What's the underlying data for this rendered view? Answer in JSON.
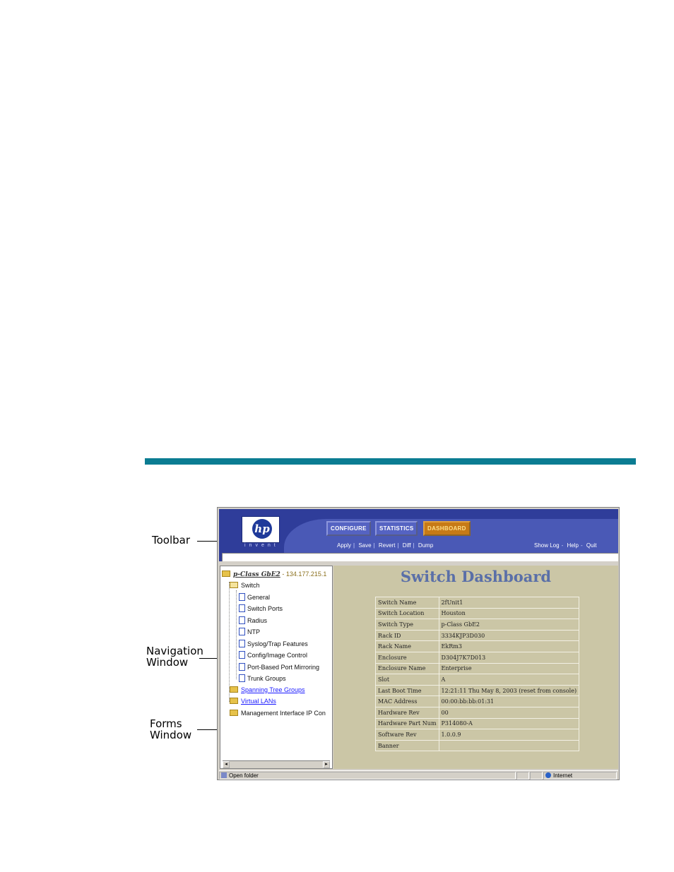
{
  "callouts": {
    "toolbar": "Toolbar",
    "navigation": [
      "Navigation",
      "Window"
    ],
    "forms": [
      "Forms",
      "Window"
    ]
  },
  "toolbar": {
    "logo_text": "hp",
    "logo_sub": "invent",
    "tabs": [
      {
        "label": "CONFIGURE",
        "active": false
      },
      {
        "label": "STATISTICS",
        "active": false
      },
      {
        "label": "DASHBOARD",
        "active": true
      }
    ],
    "actions": [
      "Apply",
      "Save",
      "Revert",
      "Diff",
      "Dump"
    ],
    "right_links": [
      "Show Log",
      "Help",
      "Quit"
    ]
  },
  "nav": {
    "root": "p-Class GbE2",
    "root_ip": "- 134.177.215.1",
    "switch": "Switch",
    "switch_items": [
      "General",
      "Switch Ports",
      "Radius",
      "NTP",
      "Syslog/Trap Features",
      "Config/Image Control",
      "Port-Based Port Mirroring",
      "Trunk Groups"
    ],
    "links": [
      "Spanning Tree Groups",
      "Virtual LANs"
    ],
    "mgmt": "Management Interface IP Con"
  },
  "forms": {
    "title": "Switch Dashboard",
    "rows": [
      {
        "label": "Switch Name",
        "value": "2fUnit1"
      },
      {
        "label": "Switch Location",
        "value": "Houston"
      },
      {
        "label": "Switch Type",
        "value": "p-Class GbE2"
      },
      {
        "label": "Rack ID",
        "value": "3334KJP3D030"
      },
      {
        "label": "Rack Name",
        "value": "EkRm3"
      },
      {
        "label": "Enclosure",
        "value": "D304J7K7D013"
      },
      {
        "label": "Enclosure Name",
        "value": "Enterprise"
      },
      {
        "label": "Slot",
        "value": "A"
      },
      {
        "label": "Last Boot Time",
        "value": "12:21:11 Thu May 8, 2003 (reset from console)"
      },
      {
        "label": "MAC Address",
        "value": "00:00:bb:bb:01:31"
      },
      {
        "label": "Hardware Rev",
        "value": "00"
      },
      {
        "label": "Hardware Part Num",
        "value": "P314080-A"
      },
      {
        "label": "Software Rev",
        "value": "1.0.0.9"
      },
      {
        "label": "Banner",
        "value": ""
      }
    ]
  },
  "status": {
    "left": "Open folder",
    "zone": "Internet"
  },
  "colors": {
    "rule": "#0b7c92",
    "toolbar_bg": "#2f3d9a",
    "forms_bg": "#cbc6a6",
    "dashboard_title": "#5a6fa8",
    "active_tab": "#c77a16"
  }
}
